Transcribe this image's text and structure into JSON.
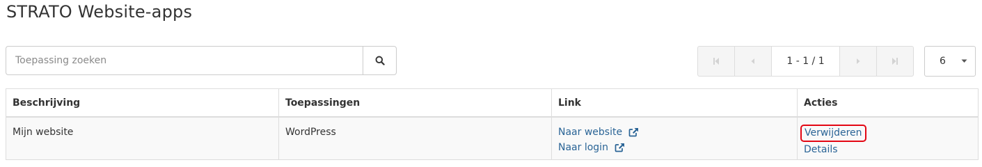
{
  "page": {
    "title": "STRATO Website-apps"
  },
  "search": {
    "placeholder": "Toepassing zoeken"
  },
  "pagination": {
    "info": "1 - 1 / 1"
  },
  "page_size": {
    "value": "6"
  },
  "table": {
    "columns": [
      "Beschrijving",
      "Toepassingen",
      "Link",
      "Acties"
    ],
    "rows": [
      {
        "beschrijving": "Mijn website",
        "toepassing": "WordPress",
        "links": [
          "Naar website",
          "Naar login"
        ],
        "acties": [
          "Verwijderen",
          "Details"
        ]
      }
    ]
  },
  "colors": {
    "link": "#2a6496",
    "highlight": "#e30613",
    "border": "#dddddd"
  }
}
